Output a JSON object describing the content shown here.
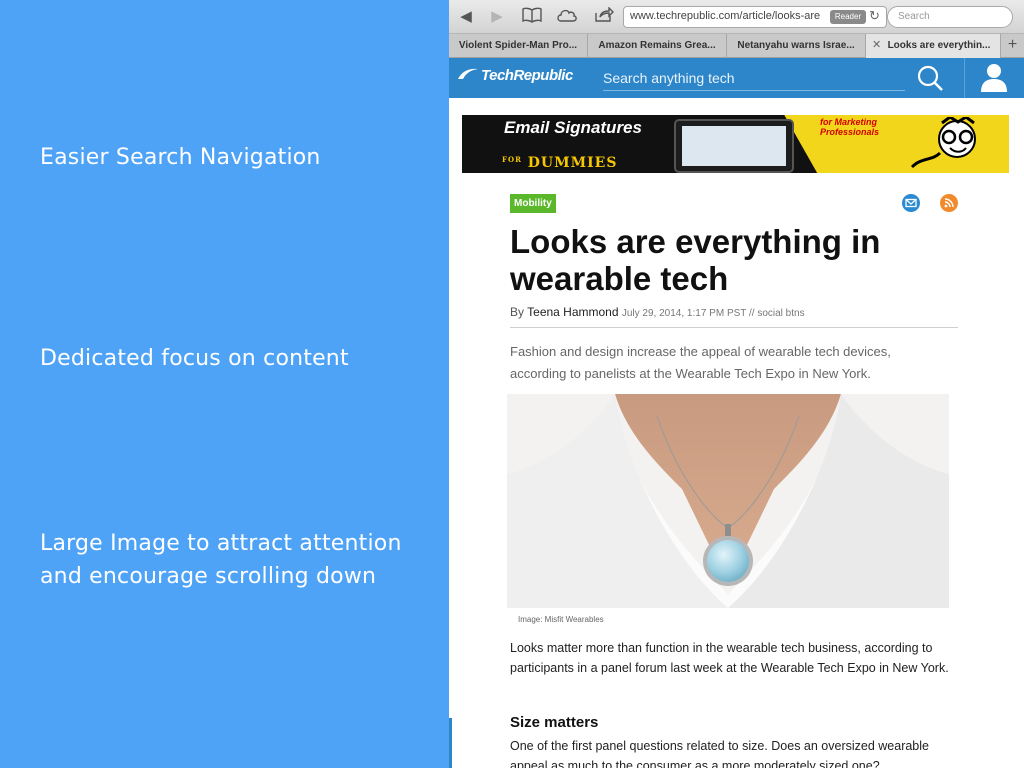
{
  "annotations": [
    "Easier Search Navigation",
    "Dedicated focus on content",
    "Large Image to attract attention and encourage scrolling down"
  ],
  "browser": {
    "url": "www.techrepublic.com/article/looks-are",
    "reader_label": "Reader",
    "search_placeholder": "Search",
    "tabs": [
      "Violent Spider-Man Pro...",
      "Amazon Remains Grea...",
      "Netanyahu warns Israe...",
      "Looks are everythin..."
    ],
    "active_tab_index": 3
  },
  "site": {
    "logo_text": "TechRepublic",
    "search_placeholder": "Search anything tech",
    "header_color": "#2d86c9"
  },
  "ad": {
    "title": "Email Signatures",
    "for_text": "FOR",
    "brand": "DUMMIES",
    "tag": "for Marketing Professionals"
  },
  "article": {
    "category": "Mobility",
    "headline": "Looks are everything in wearable tech",
    "byline_prefix": "By",
    "author": "Teena Hammond",
    "byline_meta": "July 29, 2014, 1:17 PM PST // social btns",
    "dek": "Fashion and design increase the appeal of wearable tech devices, according to panelists at the Wearable Tech Expo in New York.",
    "image_caption": "Image: Misfit Wearables",
    "paragraph_1": "Looks matter more than function in the wearable tech business, according to participants in a panel forum last week at the Wearable Tech Expo in New York.",
    "subhead": "Size matters",
    "paragraph_2": "One of the first panel questions related to size. Does an oversized wearable appeal as much to the consumer as a more moderately sized one?"
  },
  "icons": {
    "back": "back-arrow-icon",
    "forward": "forward-arrow-icon",
    "bookmarks": "book-icon",
    "cloud": "cloud-icon",
    "share": "share-icon",
    "reload": "reload-icon",
    "search": "magnifier-icon",
    "user": "user-icon",
    "email": "email-icon",
    "rss": "rss-icon"
  },
  "colors": {
    "panel_bg": "#4ea3f7",
    "category_badge": "#5cb82b",
    "email_icon": "#2a8ad2",
    "rss_icon": "#f08a2c"
  }
}
